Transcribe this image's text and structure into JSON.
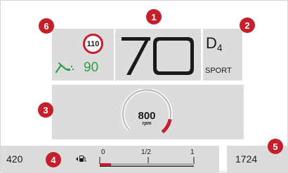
{
  "speed_limit": {
    "value": "110"
  },
  "cruise": {
    "icon": "adaptive-cruise-icon",
    "set_speed": "90",
    "color": "#2e9e4a"
  },
  "speed": {
    "value": "70"
  },
  "gear": {
    "letter": "D",
    "number": "4",
    "mode": "SPORT"
  },
  "rpm": {
    "value": "800",
    "unit": "rpm",
    "level": 0.33,
    "accent": "#c41f2b"
  },
  "range": {
    "value": "420"
  },
  "fuel": {
    "icon": "fuel-pump-icon",
    "empty_label": "0",
    "half_label": "1/2",
    "full_label": "1",
    "level": 0.12
  },
  "odometer": {
    "value": "1724"
  },
  "markers": [
    "1",
    "2",
    "3",
    "4",
    "5",
    "6"
  ],
  "colors": {
    "accent": "#c41f2b",
    "panel": "#dcdcdc"
  }
}
